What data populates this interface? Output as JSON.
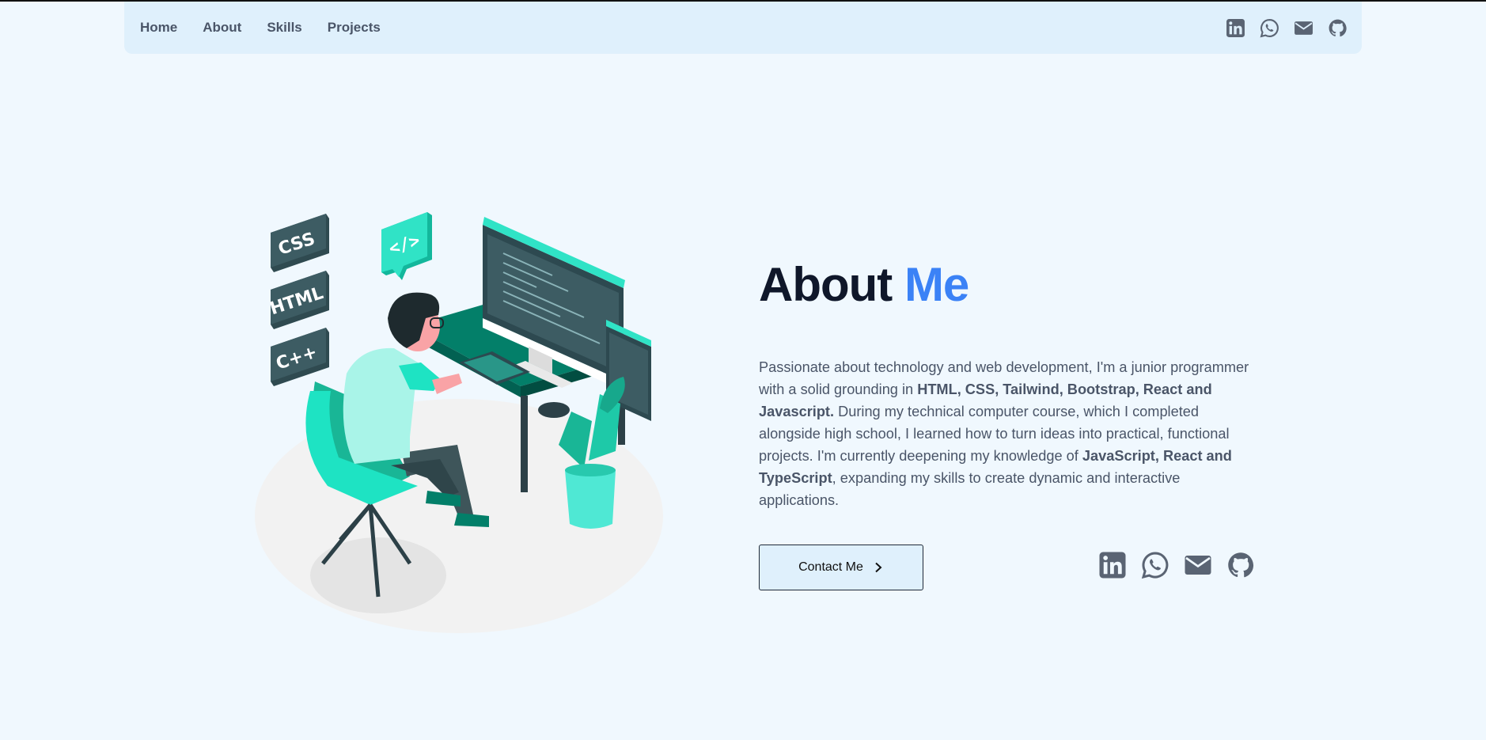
{
  "nav": {
    "links": [
      "Home",
      "About",
      "Skills",
      "Projects"
    ],
    "icons": [
      "linkedin-icon",
      "whatsapp-icon",
      "mail-icon",
      "github-icon"
    ]
  },
  "illustration": {
    "badges": [
      "CSS",
      "HTML",
      "C++"
    ],
    "code_bubble": "</>"
  },
  "about": {
    "title_main": "About",
    "title_accent": "Me",
    "bio": [
      {
        "t": "Passionate about technology and web development, I'm a junior programmer with a solid grounding in ",
        "b": false
      },
      {
        "t": "HTML, CSS, Tailwind, Bootstrap, React and Javascript.",
        "b": true
      },
      {
        "t": " During my technical computer course, which I completed alongside high school, I learned how to turn ideas into practical, functional projects. I'm currently deepening my knowledge of ",
        "b": false
      },
      {
        "t": "JavaScript, React and TypeScript",
        "b": true
      },
      {
        "t": ", expanding my skills to create dynamic and interactive applications.",
        "b": false
      }
    ],
    "contact_label": "Contact Me",
    "social_icons": [
      "linkedin-icon",
      "whatsapp-icon",
      "mail-icon",
      "github-icon"
    ]
  },
  "colors": {
    "background": "#f0f8fe",
    "navbar": "#dff0fc",
    "accent": "#3b82f6",
    "teal": "#1ee3c3",
    "dark_teal": "#037f69",
    "text": "#4a5568"
  }
}
